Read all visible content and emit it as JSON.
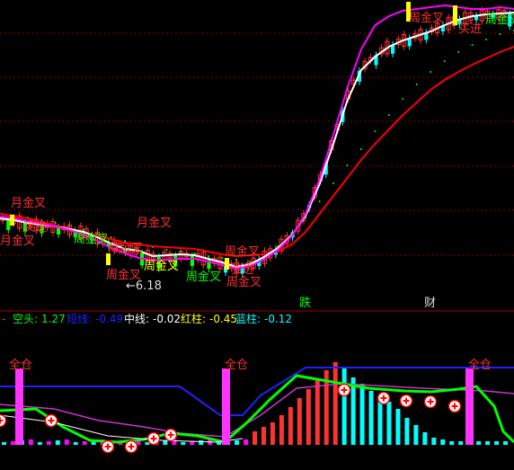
{
  "colors": {
    "background": "#000000",
    "grid": "#8a0000",
    "up": "#ff3232",
    "down": "#00ffff",
    "green_bar": "#00ff00",
    "red_line": "#ff0000",
    "white_line": "#ffffff",
    "magenta": "#ff00ff",
    "yellow": "#ffff00",
    "blue": "#2020ff",
    "label_red": "#ff3030",
    "label_green": "#00ff00"
  },
  "chart_data": [
    {
      "type": "candlestick",
      "panel": "main",
      "title": "",
      "series": [
        {
          "color": "white",
          "values": [
            243,
            245,
            248,
            250,
            252,
            255,
            258,
            264,
            271,
            277,
            279,
            285,
            284,
            283,
            284,
            288,
            292,
            297,
            294,
            286,
            276,
            262,
            240,
            205,
            160,
            112,
            78,
            63,
            52,
            45,
            40,
            35,
            28,
            22,
            18,
            16,
            15,
            14
          ]
        },
        {
          "color": "magenta",
          "values": [
            241,
            243,
            246,
            249,
            252,
            256,
            261,
            268,
            276,
            282,
            287,
            290,
            289,
            288,
            288,
            291,
            295,
            299,
            296,
            289,
            278,
            263,
            238,
            200,
            150,
            98,
            55,
            28,
            18,
            12,
            10,
            8,
            6,
            8,
            10,
            10,
            8,
            10
          ]
        },
        {
          "color": "red",
          "values": [
            238,
            240,
            243,
            247,
            251,
            254,
            258,
            262,
            266,
            270,
            272,
            274,
            275,
            276,
            277,
            280,
            283,
            285,
            284,
            283,
            280,
            272,
            258,
            238,
            218,
            198,
            178,
            160,
            144,
            128,
            114,
            100,
            89,
            80,
            72,
            65,
            58,
            52
          ]
        },
        {
          "color": "green-dots",
          "values": [
            232,
            235,
            238,
            241,
            244,
            248,
            252,
            256,
            260,
            264,
            268,
            271,
            274,
            276,
            278,
            281,
            283,
            285,
            287,
            284,
            270,
            255,
            238,
            220,
            200,
            180,
            162,
            142,
            124,
            106,
            90,
            76,
            64,
            54,
            46,
            40,
            34,
            30
          ]
        }
      ],
      "labels": [
        "月金叉",
        "买进",
        "月金叉",
        "周金叉",
        "月金叉",
        "月金叉",
        "周金叉",
        "←6.18",
        "周金叉",
        "周金叉",
        "周金叉",
        "买进",
        "周金叉",
        "周金叉",
        "买进",
        "周金叉"
      ],
      "bottom_markers": [
        "跌",
        "财"
      ]
    },
    {
      "type": "bar",
      "panel": "indicator",
      "legend": [
        {
          "name": "空头:",
          "value": "1.27",
          "color": "#00ff00"
        },
        {
          "name": "短线:",
          "value": "-0.49",
          "color": "#2020ff"
        },
        {
          "name": "中线:",
          "value": "-0.02",
          "color": "#ffffff"
        },
        {
          "name": "红柱:",
          "value": "-0.45",
          "color": "#ffff00"
        },
        {
          "name": "蓝柱:",
          "value": "-0.12",
          "color": "#00ffff"
        }
      ],
      "marker_label": "全仓",
      "series": [
        {
          "name": "red-bars",
          "values": [
            0,
            0,
            0,
            0,
            0,
            0,
            0,
            0,
            0,
            0,
            0,
            0,
            0,
            0,
            0,
            0,
            0,
            0,
            0,
            0,
            0,
            0,
            0,
            0,
            0,
            0,
            0,
            0,
            15,
            20,
            25,
            33,
            42,
            52,
            62,
            72,
            83,
            92,
            0,
            0,
            0,
            0,
            0,
            0,
            0,
            0,
            0,
            0,
            0,
            0,
            0,
            0,
            0,
            0,
            0,
            0,
            0
          ]
        },
        {
          "name": "cyan-bars",
          "values": [
            0,
            0,
            0,
            0,
            0,
            0,
            0,
            0,
            0,
            0,
            0,
            0,
            0,
            0,
            0,
            0,
            0,
            0,
            0,
            0,
            0,
            0,
            0,
            0,
            0,
            0,
            0,
            0,
            0,
            0,
            0,
            0,
            0,
            0,
            0,
            0,
            0,
            0,
            85,
            75,
            68,
            60,
            55,
            48,
            40,
            30,
            22,
            14,
            8,
            6,
            4,
            4,
            4,
            4,
            4,
            4,
            4
          ]
        }
      ]
    }
  ]
}
